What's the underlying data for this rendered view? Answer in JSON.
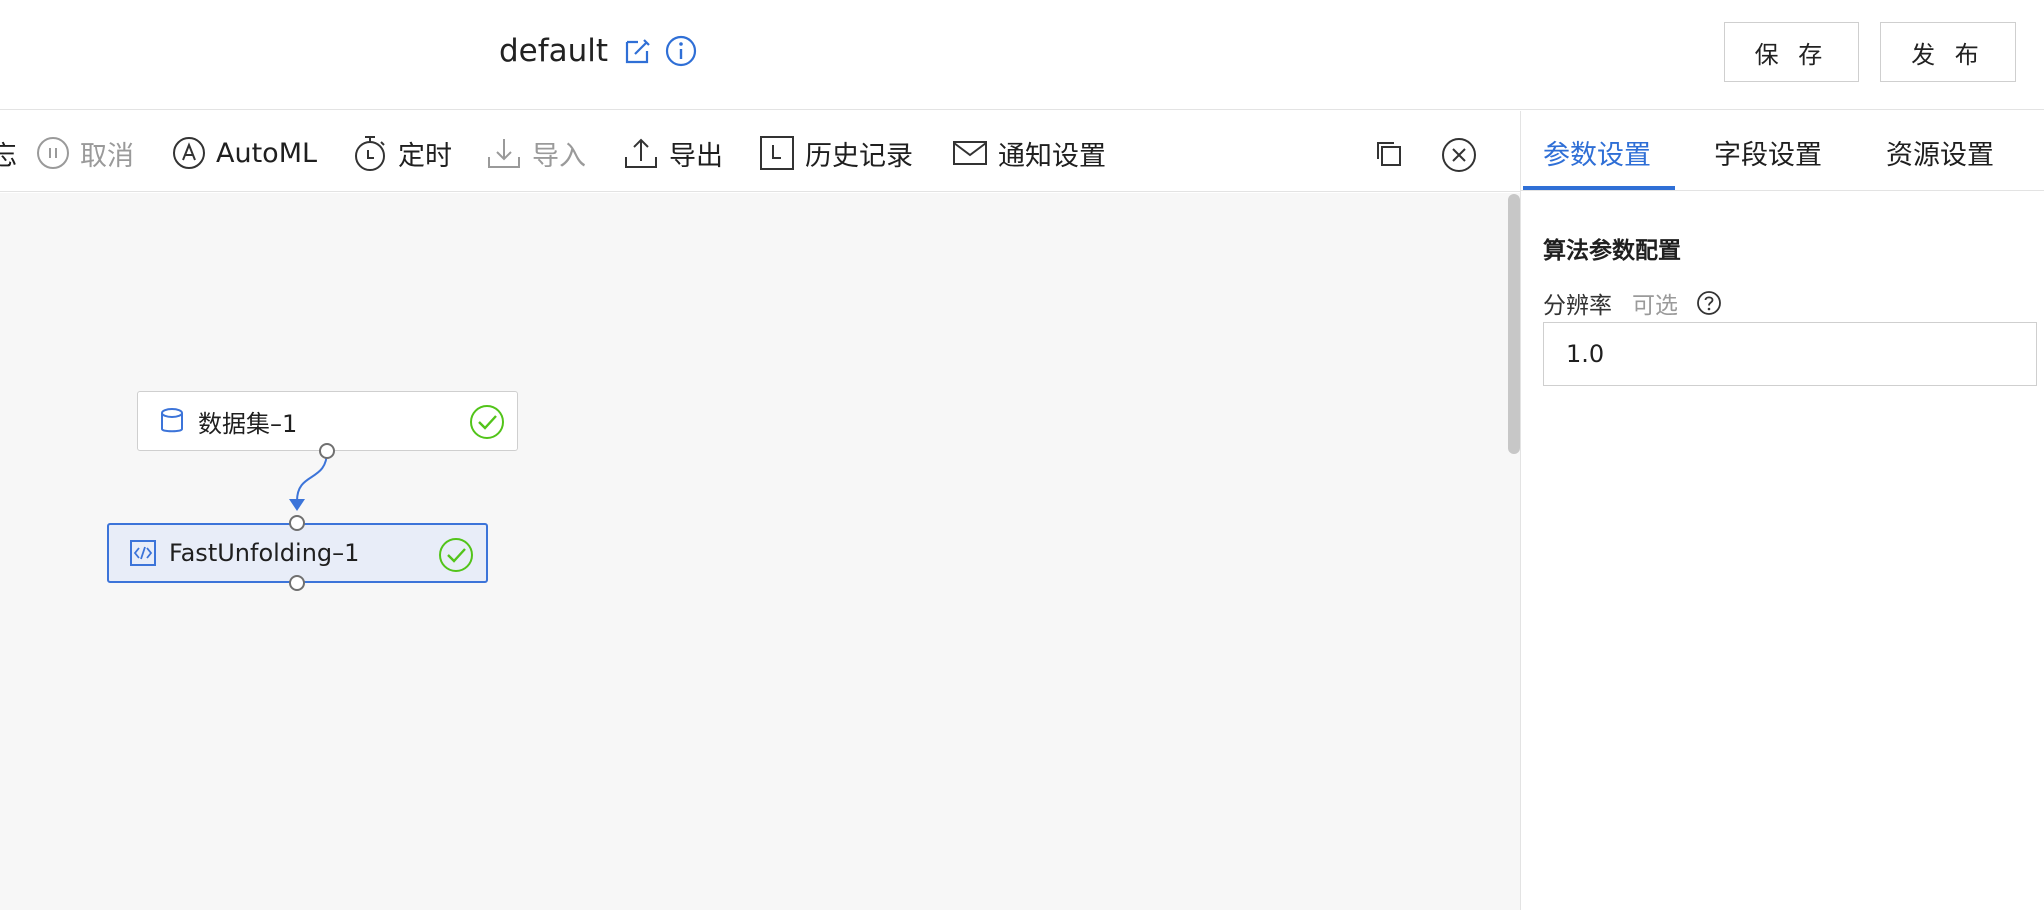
{
  "header": {
    "title": "default",
    "save_label": "保 存",
    "publish_label": "发 布"
  },
  "toolbar": {
    "truncated_fragment": "忘",
    "items": [
      {
        "label": "取消",
        "icon": "pause-circle-icon",
        "disabled": true
      },
      {
        "label": "AutoML",
        "icon": "automl-icon",
        "disabled": false
      },
      {
        "label": "定时",
        "icon": "timer-icon",
        "disabled": false
      },
      {
        "label": "导入",
        "icon": "import-icon",
        "disabled": true
      },
      {
        "label": "导出",
        "icon": "export-icon",
        "disabled": false
      },
      {
        "label": "历史记录",
        "icon": "history-icon",
        "disabled": false
      },
      {
        "label": "通知设置",
        "icon": "mail-icon",
        "disabled": false
      }
    ]
  },
  "canvas": {
    "nodes": [
      {
        "label": "数据集–1",
        "icon": "database-icon",
        "status": "success",
        "selected": false
      },
      {
        "label": "FastUnfolding–1",
        "icon": "code-icon",
        "status": "success",
        "selected": true
      }
    ]
  },
  "panel": {
    "tabs": [
      {
        "label": "参数设置",
        "active": true
      },
      {
        "label": "字段设置",
        "active": false
      },
      {
        "label": "资源设置",
        "active": false
      }
    ],
    "section_title": "算法参数配置",
    "field": {
      "label": "分辨率",
      "optional": "可选",
      "value": "1.0"
    }
  },
  "colors": {
    "accent": "#2f6fd6",
    "success": "#52c41a",
    "node_selected_bg": "#e8edf8",
    "canvas_bg": "#f7f7f7"
  }
}
